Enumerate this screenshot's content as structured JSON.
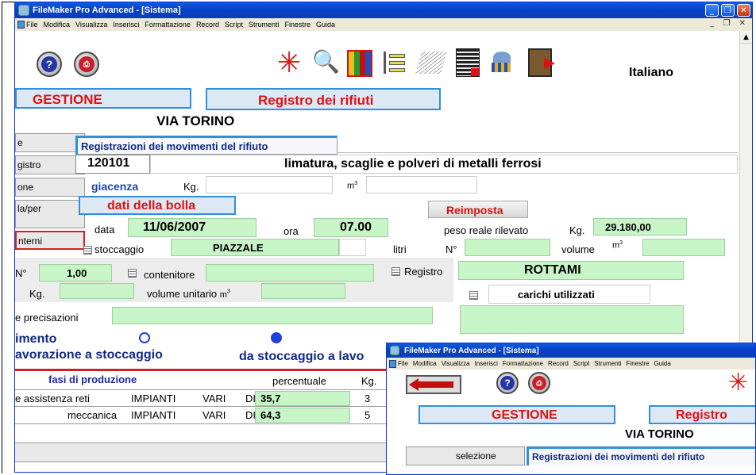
{
  "main_window": {
    "title": "FileMaker Pro Advanced - [Sistema]",
    "menu": [
      "File",
      "Modifica",
      "Visualizza",
      "Inserisci",
      "Formattazione",
      "Record",
      "Script",
      "Strumenti",
      "Finestre",
      "Guida"
    ],
    "language": "Italiano",
    "gestione_label": "GESTIONE",
    "registro_rifiuti_label": "Registro dei rifiuti",
    "location": "VIA TORINO",
    "sidebar": [
      "e",
      "gistro",
      "one",
      "la/per",
      "nterni"
    ],
    "section_title": "Registrazioni dei movimenti del rifiuto",
    "cer_code": "120101",
    "waste_description": "limatura, scaglie e polveri di metalli ferrosi",
    "giacenza_label": "giacenza",
    "kg_label": "Kg.",
    "m3_label": "m",
    "m3_sup": "3",
    "dati_bolla_label": "dati della bolla",
    "reimposta_label": "Reimposta",
    "data_label": "data",
    "data_value": "11/06/2007",
    "ora_label": "ora",
    "ora_value": "07.00",
    "peso_label": "peso reale rilevato",
    "peso_value": "29.180,00",
    "stoccaggio_label": "stoccaggio",
    "stoccaggio_value": "PIAZZALE",
    "litri_label": "litri",
    "n_label": "N°",
    "volume_label": "volume",
    "registro_label": "Registro",
    "registro_value": "ROTTAMI",
    "n_short": "N°",
    "n_value": "1,00",
    "contenitore_label": "contenitore",
    "volume_unitario_label": "volume unitario",
    "carichi_label": "carichi utilizzati",
    "precisazioni_label": "e precisazioni",
    "movimento_label": "imento",
    "radio_1": "avorazione a stoccaggio",
    "radio_2": "da stoccaggio a lavo",
    "fasi_label": "fasi di produzione",
    "percentuale_label": "percentuale",
    "kg_col_label": "Kg.",
    "rows": [
      {
        "a": "e  assistenza  reti",
        "b": "IMPIANTI",
        "c": "VARI",
        "d": "DI",
        "pct": "35,7",
        "e": "3"
      },
      {
        "a": "meccanica",
        "b": "IMPIANTI",
        "c": "VARI",
        "d": "DI",
        "pct": "64,3",
        "e": "5"
      }
    ]
  },
  "overlay_window": {
    "title": "FileMaker Pro Advanced - [Sistema]",
    "menu": [
      "File",
      "Modifica",
      "Visualizza",
      "Inserisci",
      "Formattazione",
      "Record",
      "Script",
      "Strumenti",
      "Finestre",
      "Guida"
    ],
    "gestione_label": "GESTIONE",
    "registro_label": "Registro",
    "location": "VIA TORINO",
    "selezione_label": "selezione",
    "section_title": "Registrazioni dei movimenti del rifiuto"
  }
}
